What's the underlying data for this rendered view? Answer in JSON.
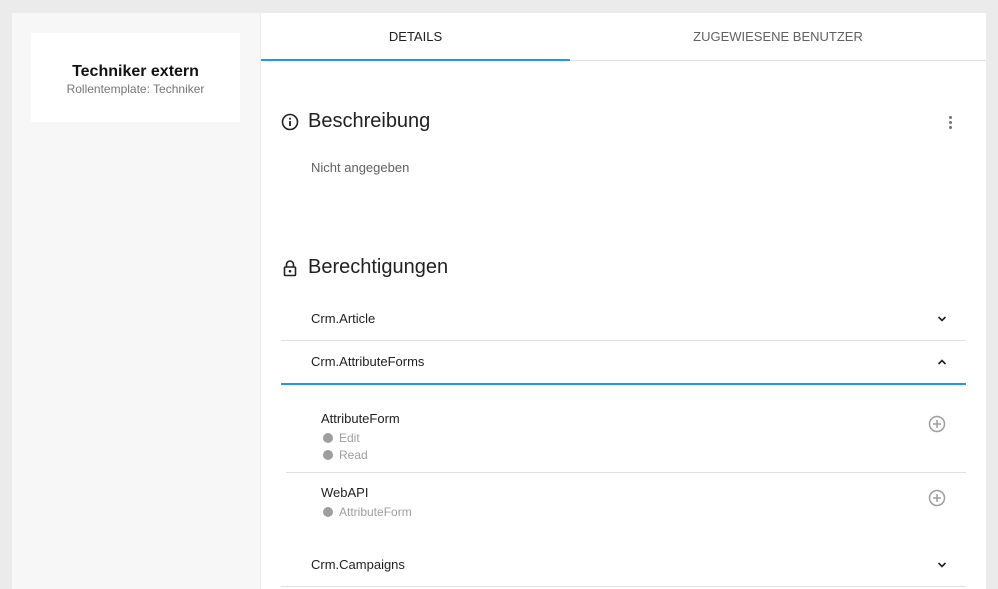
{
  "role": {
    "name": "Techniker extern",
    "template": "Rollentemplate: Techniker"
  },
  "tabs": [
    {
      "label": "DETAILS",
      "active": true
    },
    {
      "label": "ZUGEWIESENE BENUTZER",
      "active": false
    }
  ],
  "description": {
    "title": "Beschreibung",
    "text": "Nicht angegeben",
    "icon": "info-icon"
  },
  "permissions": {
    "title": "Berechtigungen",
    "icon": "lock-icon",
    "groups": [
      {
        "name": "Crm.Article",
        "expanded": false
      },
      {
        "name": "Crm.AttributeForms",
        "expanded": true,
        "items": [
          {
            "name": "AttributeForm",
            "rights": [
              "Edit",
              "Read"
            ]
          },
          {
            "name": "WebAPI",
            "rights": [
              "AttributeForm"
            ]
          }
        ]
      },
      {
        "name": "Crm.Campaigns",
        "expanded": false
      }
    ]
  },
  "colors": {
    "accent": "#2196f3",
    "background": "#ebebeb",
    "muted": "#9e9e9e"
  }
}
